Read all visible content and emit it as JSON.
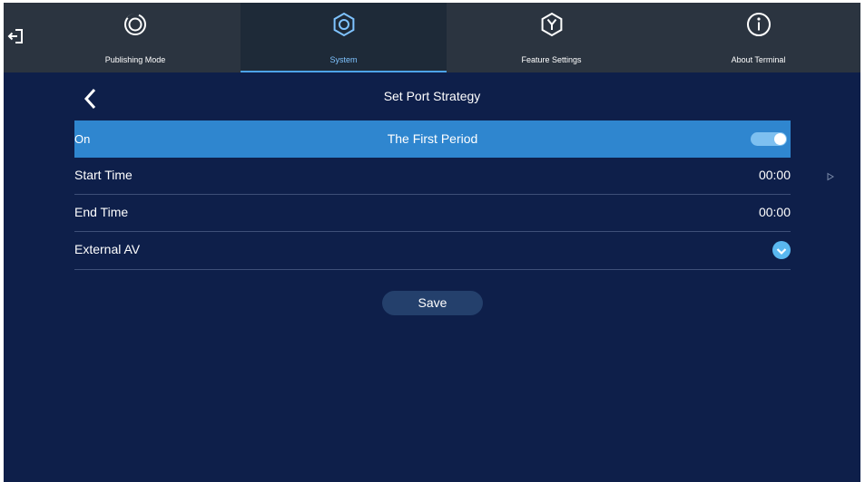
{
  "nav": {
    "tabs": [
      {
        "label": "Publishing Mode",
        "icon": "publishing-mode-icon"
      },
      {
        "label": "System",
        "icon": "gear-icon",
        "active": true
      },
      {
        "label": "Feature Settings",
        "icon": "feature-settings-icon"
      },
      {
        "label": "About Terminal",
        "icon": "info-icon"
      }
    ]
  },
  "header": {
    "title": "Set Port Strategy"
  },
  "period": {
    "status_label": "On",
    "title": "The First Period",
    "enabled": true
  },
  "rows": {
    "start_time": {
      "label": "Start Time",
      "value": "00:00"
    },
    "end_time": {
      "label": "End Time",
      "value": "00:00"
    },
    "external_av": {
      "label": "External AV",
      "checked": true
    }
  },
  "actions": {
    "save_label": "Save"
  },
  "colors": {
    "background": "#0e1f4a",
    "topbar": "#2b3440",
    "accent": "#2f86cf",
    "active_tab_text": "#7fc3ff",
    "toggle_on": "#7ec0f0",
    "check": "#5ab8f0"
  }
}
